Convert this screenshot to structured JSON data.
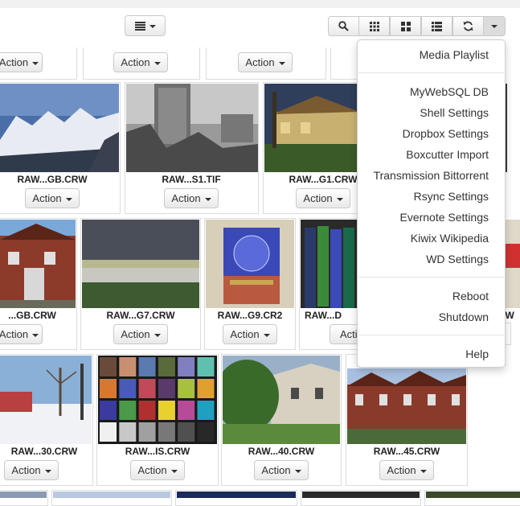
{
  "toolbar": {
    "view_button_icon": "list-view-icon",
    "tools": [
      {
        "name": "search-button",
        "icon": "search-icon"
      },
      {
        "name": "grid-small-button",
        "icon": "grid-small-icon"
      },
      {
        "name": "grid-large-button",
        "icon": "grid-large-icon"
      },
      {
        "name": "list-button",
        "icon": "list-icon"
      },
      {
        "name": "refresh-button",
        "icon": "refresh-icon"
      },
      {
        "name": "menu-toggle-button",
        "icon": "caret-down-icon"
      }
    ]
  },
  "action_label": "Action",
  "files": [
    {
      "name": "RAW...GB.CRW"
    },
    {
      "name": "RAW...S1.TIF"
    },
    {
      "name": "RAW...G1.CRW"
    },
    {
      "name": "...GB.CRW"
    },
    {
      "name": "RAW...G7.CRW"
    },
    {
      "name": "RAW...G9.CR2"
    },
    {
      "name": "RAW...D"
    },
    {
      "name": "RW"
    },
    {
      "name": "RAW...30.CRW"
    },
    {
      "name": "RAW...IS.CRW"
    },
    {
      "name": "RAW...40.CRW"
    },
    {
      "name": "RAW...45.CRW"
    }
  ],
  "menu": {
    "items": [
      "Media Playlist",
      "MyWebSQL DB",
      "Shell Settings",
      "Dropbox Settings",
      "Boxcutter Import",
      "Transmission Bittorrent",
      "Rsync Settings",
      "Evernote Settings",
      "Kiwix Wikipedia",
      "WD Settings",
      "Reboot",
      "Shutdown",
      "Help"
    ]
  }
}
